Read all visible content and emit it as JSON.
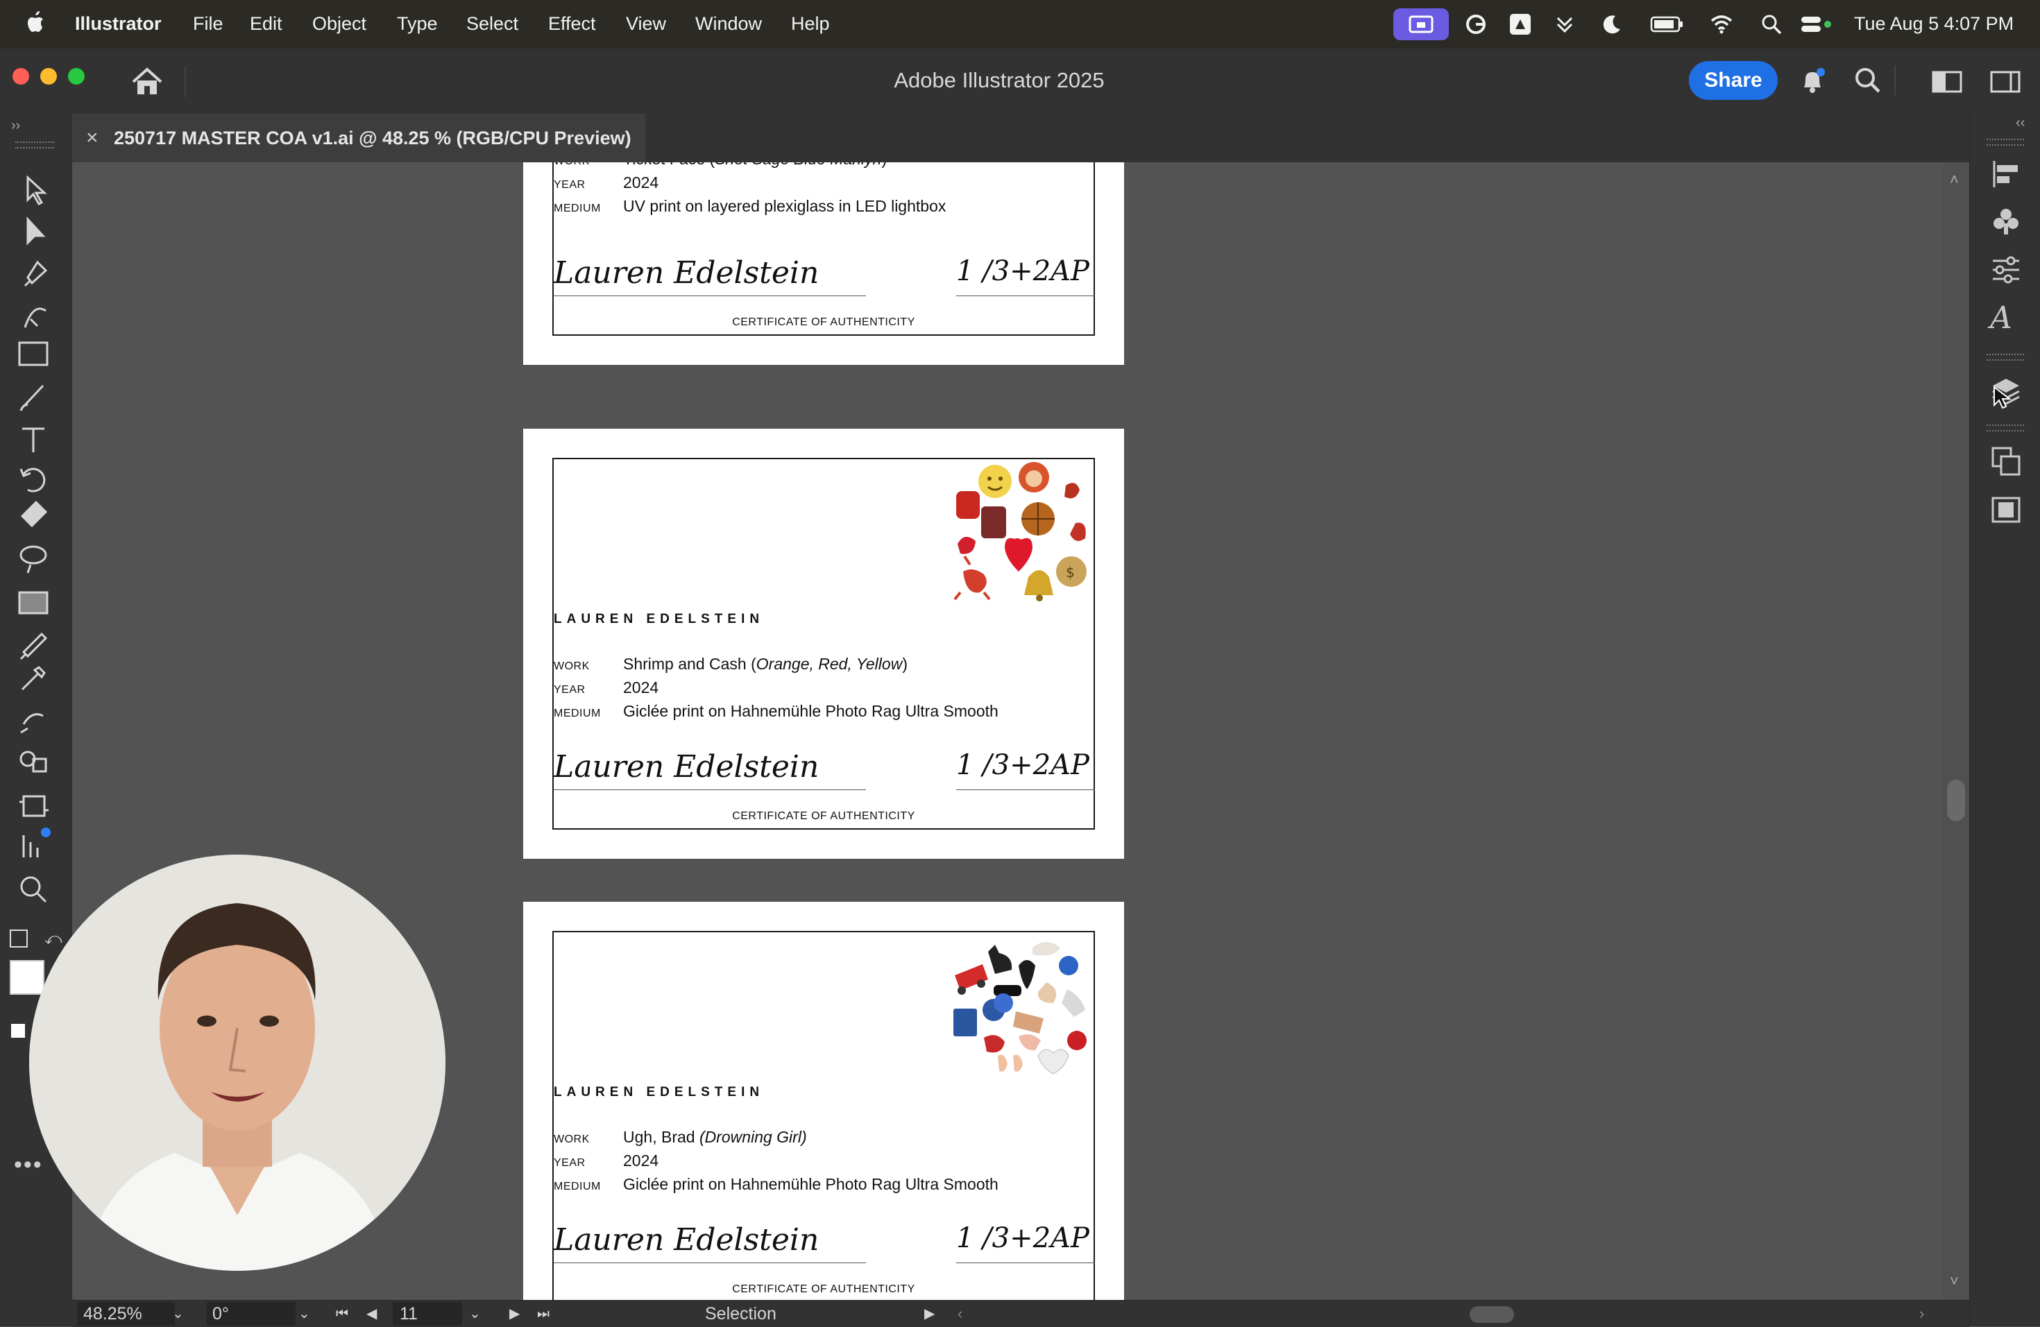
{
  "menubar": {
    "app_name": "Illustrator",
    "items": [
      "File",
      "Edit",
      "Object",
      "Type",
      "Select",
      "Effect",
      "View",
      "Window",
      "Help"
    ],
    "datetime": "Tue Aug 5  4:07 PM"
  },
  "window": {
    "title": "Adobe Illustrator 2025",
    "share_label": "Share"
  },
  "document_tab": {
    "title": "250717 MASTER COA v1.ai @ 48.25 % (RGB/CPU Preview)"
  },
  "cards": [
    {
      "artist": "",
      "work_label": "WORK",
      "work_title": "Ticket Face",
      "work_subtitle": "Shot Sage Blue Marilyn",
      "year_label": "YEAR",
      "year": "2024",
      "medium_label": "MEDIUM",
      "medium": "UV print on layered plexiglass in LED lightbox",
      "signature": "Lauren Edelstein",
      "edition": "1  /3+2AP",
      "footer": "CERTIFICATE OF AUTHENTICITY"
    },
    {
      "artist": "LAUREN EDELSTEIN",
      "work_label": "WORK",
      "work_title": "Shrimp and Cash",
      "work_subtitle": "Orange, Red, Yellow",
      "year_label": "YEAR",
      "year": "2024",
      "medium_label": "MEDIUM",
      "medium": "Giclée print on Hahnemühle Photo Rag Ultra Smooth",
      "signature": "Lauren Edelstein",
      "edition": "1  /3+2AP",
      "footer": "CERTIFICATE OF AUTHENTICITY"
    },
    {
      "artist": "LAUREN EDELSTEIN",
      "work_label": "WORK",
      "work_title": "Ugh, Brad",
      "work_subtitle": "Drowning Girl",
      "year_label": "YEAR",
      "year": "2024",
      "medium_label": "MEDIUM",
      "medium": "Giclée print on Hahnemühle Photo Rag Ultra Smooth",
      "signature": "Lauren Edelstein",
      "edition": "1  /3+2AP",
      "footer": "CERTIFICATE OF AUTHENTICITY"
    }
  ],
  "statusbar": {
    "zoom": "48.25%",
    "rotation": "0°",
    "artboard_number": "11",
    "tool_name": "Selection"
  },
  "icons": {
    "toolbar": [
      "selection-tool-icon",
      "direct-selection-tool-icon",
      "pen-tool-icon",
      "curvature-tool-icon",
      "rectangle-tool-icon",
      "paintbrush-tool-icon",
      "type-tool-icon",
      "rotate-tool-icon",
      "eraser-tool-icon",
      "lasso-tool-icon",
      "gradient-tool-icon",
      "eyedropper-tool-icon",
      "shape-builder-tool-icon",
      "blend-tool-icon",
      "artboard-tool-icon",
      "graph-tool-icon",
      "zoom-tool-icon"
    ],
    "dock": [
      "align-panel-icon",
      "symbols-panel-icon",
      "properties-panel-icon",
      "character-panel-icon",
      "layers-panel-icon",
      "artboards-panel-icon",
      "libraries-panel-icon"
    ]
  },
  "colors": {
    "share_button": "#1f6fe5",
    "canvas": "#535353",
    "chrome": "#323232",
    "menubar": "#2b2a24"
  }
}
